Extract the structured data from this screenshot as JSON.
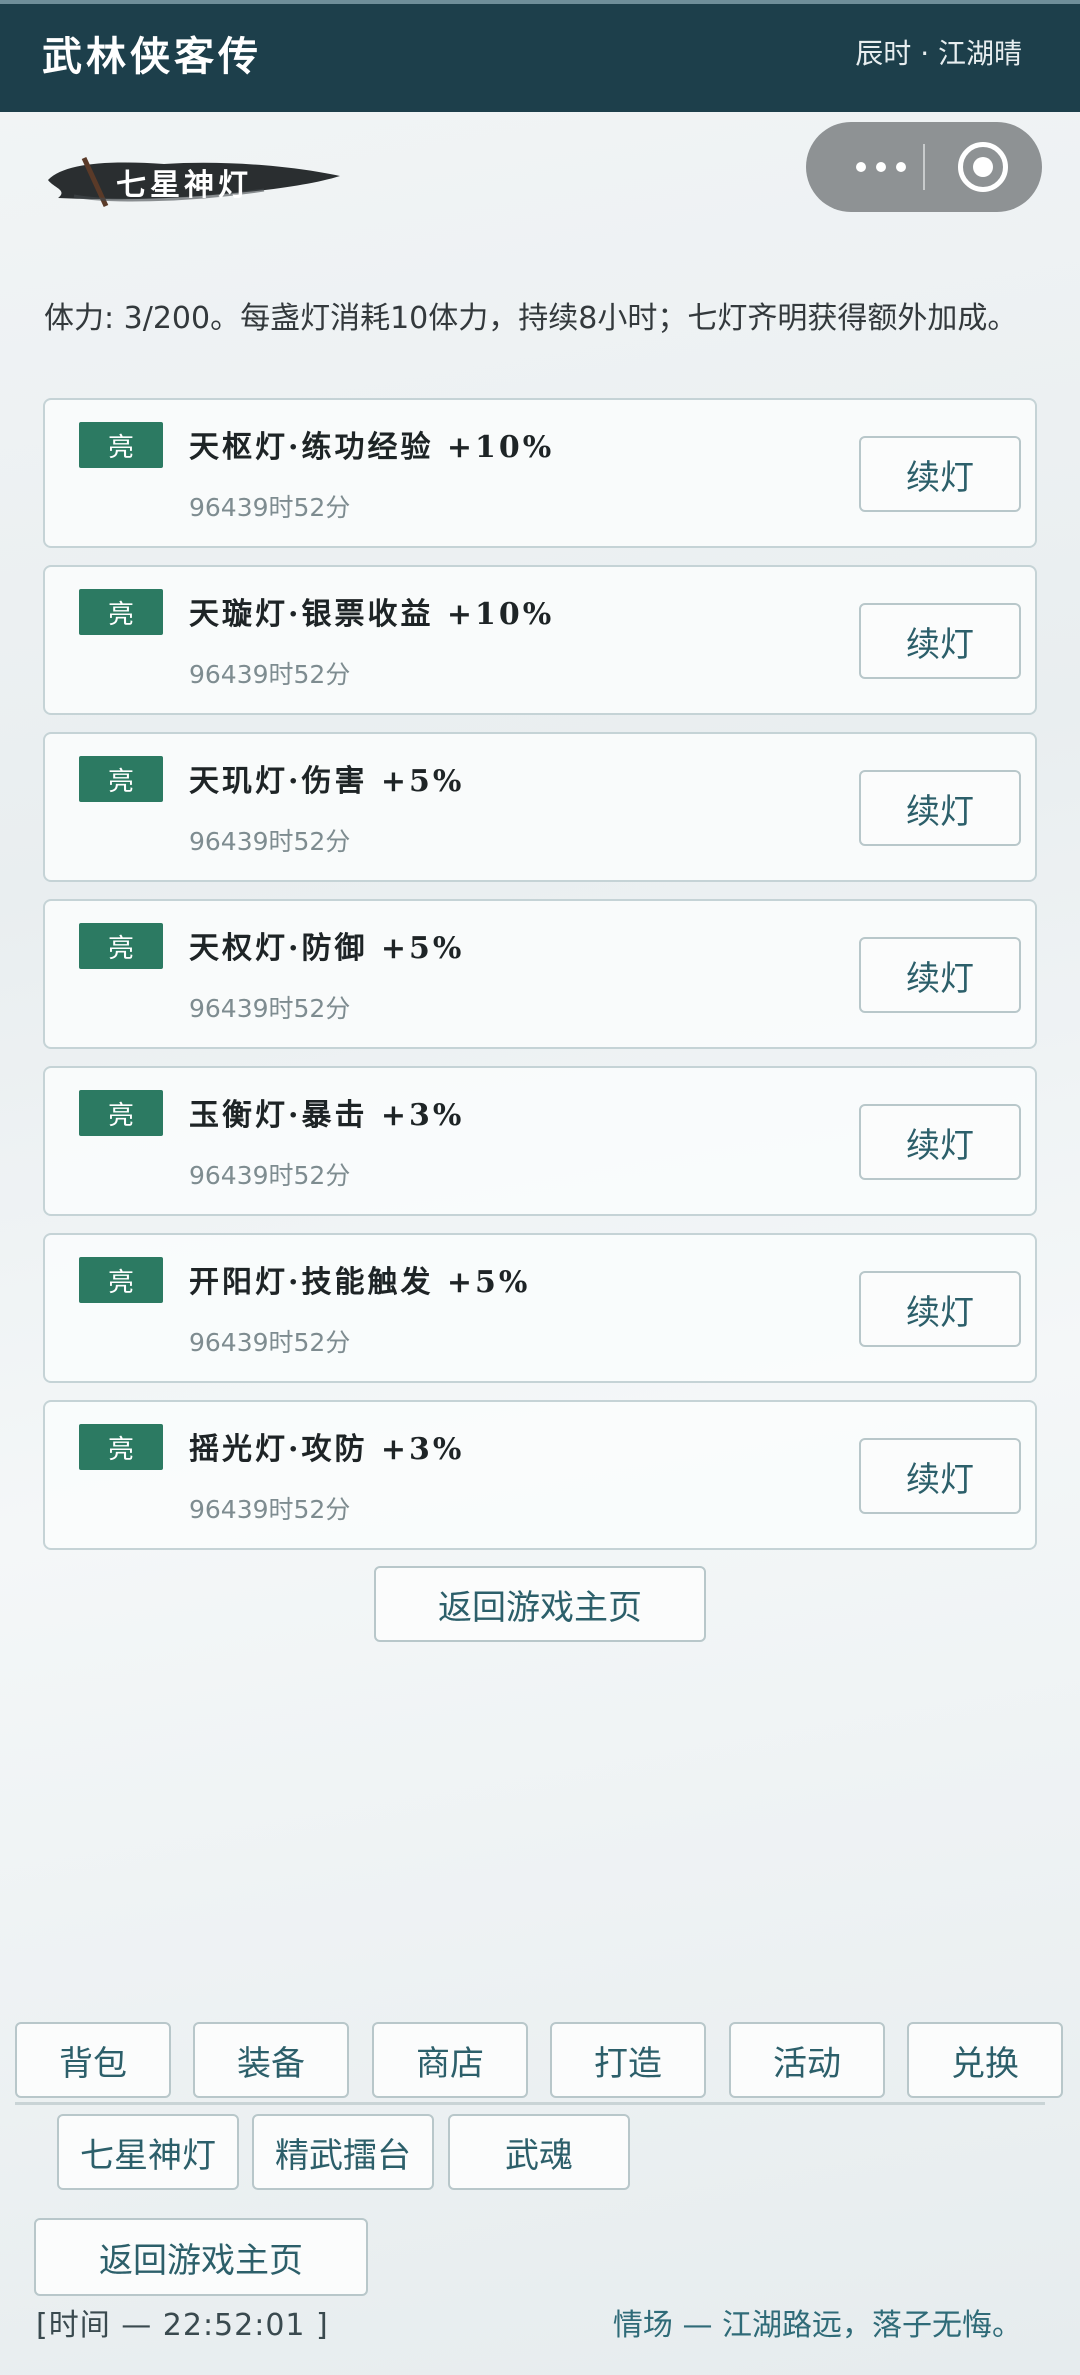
{
  "app": {
    "title": "武林侠客传",
    "status": "辰时 · 江湖晴"
  },
  "section": {
    "title": "七星神灯"
  },
  "intro": "体力: 3/200。每盏灯消耗10体力，持续8小时；七灯齐明获得额外加成。",
  "lamps": [
    {
      "badge": "亮",
      "name": "天枢灯·练功经验 +10%",
      "time": "96439时52分",
      "button": "续灯"
    },
    {
      "badge": "亮",
      "name": "天璇灯·银票收益 +10%",
      "time": "96439时52分",
      "button": "续灯"
    },
    {
      "badge": "亮",
      "name": "天玑灯·伤害 +5%",
      "time": "96439时52分",
      "button": "续灯"
    },
    {
      "badge": "亮",
      "name": "天权灯·防御 +5%",
      "time": "96439时52分",
      "button": "续灯"
    },
    {
      "badge": "亮",
      "name": "玉衡灯·暴击 +3%",
      "time": "96439时52分",
      "button": "续灯"
    },
    {
      "badge": "亮",
      "name": "开阳灯·技能触发 +5%",
      "time": "96439时52分",
      "button": "续灯"
    },
    {
      "badge": "亮",
      "name": "摇光灯·攻防 +3%",
      "time": "96439时52分",
      "button": "续灯"
    }
  ],
  "main_return": "返回游戏主页",
  "nav": {
    "row1": [
      "背包",
      "装备",
      "商店",
      "打造",
      "活动",
      "兑换"
    ],
    "row2": [
      "七星神灯",
      "精武擂台",
      "武魂"
    ]
  },
  "footer": {
    "return_button": "返回游戏主页",
    "clock": "[时间 — 22:52:01 ]",
    "scene": "情场 — 江湖路远，落子无悔。"
  },
  "colors": {
    "topbar": "#1d3f4b",
    "badge": "#2c7a62",
    "button_text": "#2c5f6a"
  }
}
